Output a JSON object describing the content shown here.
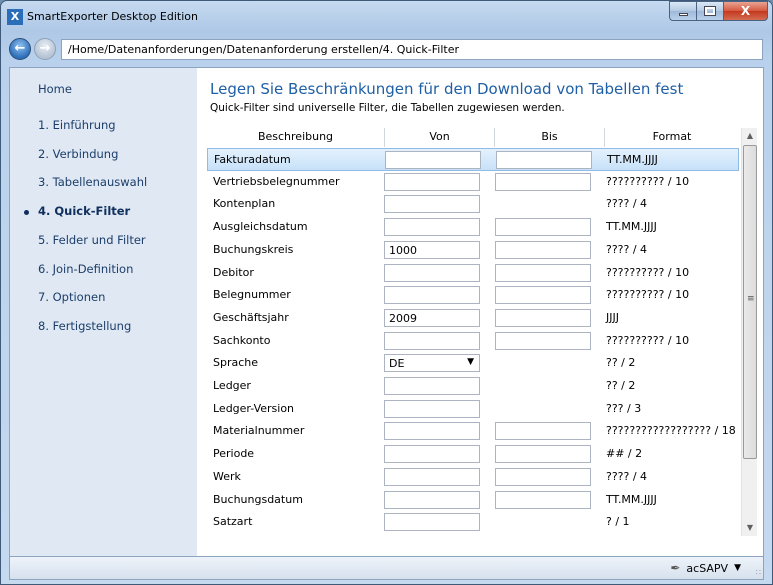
{
  "window": {
    "title": "SmartExporter Desktop Edition",
    "app_icon_glyph": "X"
  },
  "titlebar_buttons": {
    "minimize_icon": "minimize-icon",
    "maximize_icon": "maximize-icon",
    "close_label": "X"
  },
  "nav": {
    "address": "/Home/Datenanforderungen/Datenanforderung erstellen/4. Quick-Filter"
  },
  "sidebar": {
    "home": "Home",
    "items": [
      {
        "label": "1. Einführung",
        "active": false
      },
      {
        "label": "2. Verbindung",
        "active": false
      },
      {
        "label": "3. Tabellenauswahl",
        "active": false
      },
      {
        "label": "4. Quick-Filter",
        "active": true
      },
      {
        "label": "5. Felder und Filter",
        "active": false
      },
      {
        "label": "6. Join-Definition",
        "active": false
      },
      {
        "label": "7. Optionen",
        "active": false
      },
      {
        "label": "8. Fertigstellung",
        "active": false
      }
    ]
  },
  "main": {
    "heading": "Legen Sie Beschränkungen für den Download von Tabellen fest",
    "subheading": "Quick-Filter sind universelle Filter, die Tabellen zugewiesen werden."
  },
  "table": {
    "headers": {
      "beschreibung": "Beschreibung",
      "von": "Von",
      "bis": "Bis",
      "format": "Format"
    },
    "rows": [
      {
        "label": "Fakturadatum",
        "von": "",
        "bis": "",
        "has_bis": true,
        "format": "TT.MM.JJJJ",
        "selected": true
      },
      {
        "label": "Vertriebsbelegnummer",
        "von": "",
        "bis": "",
        "has_bis": true,
        "format": "?????????? / 10"
      },
      {
        "label": "Kontenplan",
        "von": "",
        "has_bis": false,
        "format": "???? / 4"
      },
      {
        "label": "Ausgleichsdatum",
        "von": "",
        "bis": "",
        "has_bis": true,
        "format": "TT.MM.JJJJ"
      },
      {
        "label": "Buchungskreis",
        "von": "1000",
        "bis": "",
        "has_bis": true,
        "format": "???? / 4"
      },
      {
        "label": "Debitor",
        "von": "",
        "bis": "",
        "has_bis": true,
        "format": "?????????? / 10"
      },
      {
        "label": "Belegnummer",
        "von": "",
        "bis": "",
        "has_bis": true,
        "format": "?????????? / 10"
      },
      {
        "label": "Geschäftsjahr",
        "von": "2009",
        "bis": "",
        "has_bis": true,
        "format": "JJJJ"
      },
      {
        "label": "Sachkonto",
        "von": "",
        "bis": "",
        "has_bis": true,
        "format": "?????????? / 10"
      },
      {
        "label": "Sprache",
        "von": "DE",
        "dropdown": true,
        "has_bis": false,
        "format": "?? / 2"
      },
      {
        "label": "Ledger",
        "von": "",
        "has_bis": false,
        "format": "?? / 2"
      },
      {
        "label": "Ledger-Version",
        "von": "",
        "has_bis": false,
        "format": "??? / 3"
      },
      {
        "label": "Materialnummer",
        "von": "",
        "bis": "",
        "has_bis": true,
        "format": "?????????????????? / 18"
      },
      {
        "label": "Periode",
        "von": "",
        "bis": "",
        "has_bis": true,
        "format": "## / 2"
      },
      {
        "label": "Werk",
        "von": "",
        "bis": "",
        "has_bis": true,
        "format": "???? / 4"
      },
      {
        "label": "Buchungsdatum",
        "von": "",
        "bis": "",
        "has_bis": true,
        "format": "TT.MM.JJJJ"
      },
      {
        "label": "Satzart",
        "von": "",
        "has_bis": false,
        "format": "? / 1"
      }
    ]
  },
  "scrollbar": {
    "up_icon": "scroll-up-icon",
    "down_icon": "scroll-down-icon"
  },
  "status": {
    "user": "acSAPV"
  }
}
